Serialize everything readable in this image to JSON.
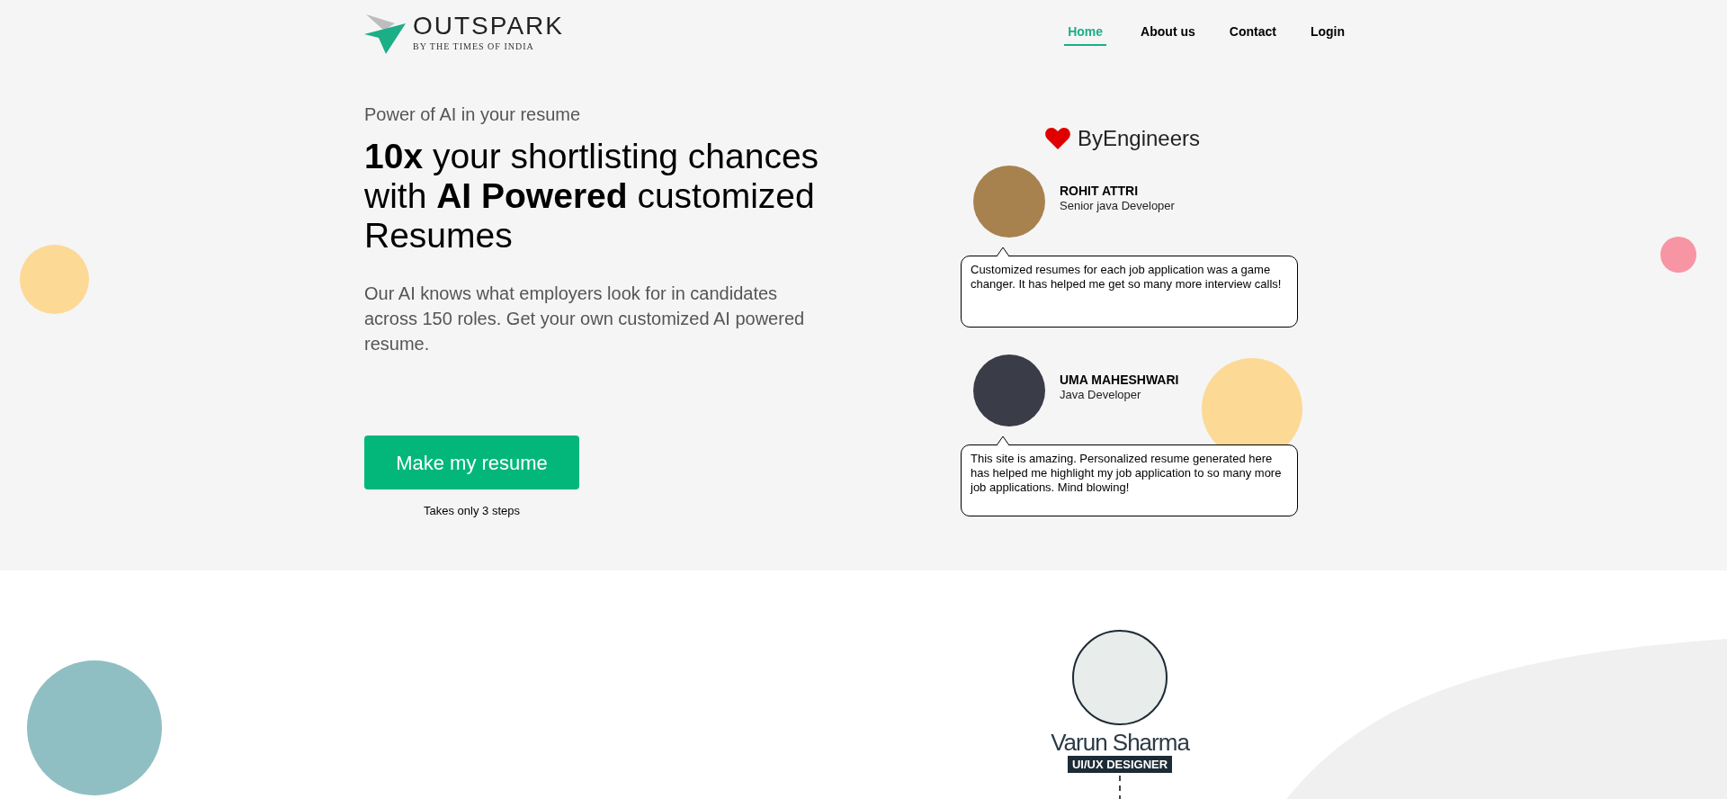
{
  "logo": {
    "name": "OUTSPARK",
    "tagline": "BY THE TIMES OF INDIA"
  },
  "nav": [
    {
      "label": "Home",
      "selected": true
    },
    {
      "label": "About us",
      "selected": false
    },
    {
      "label": "Contact",
      "selected": false
    },
    {
      "label": "Login",
      "selected": false
    }
  ],
  "hero": {
    "eyebrow": "Power of AI in your resume",
    "headline": "**10x** your shortlisting chances with **AI Powered** customized Resumes",
    "description": "Our AI knows what employers look for in candidates across 150 roles. Get your own customized AI powered resume.",
    "button": "Make my resume",
    "button_note": "Takes only 3 steps"
  },
  "testimonials": {
    "title": "ByEngineers",
    "items": [
      {
        "name": "ROHIT ATTRI",
        "role": "Senior java Developer",
        "quote": "Customized resumes for each job application was a game changer. It has helped me get so many more interview calls!"
      },
      {
        "name": "UMA MAHESHWARI",
        "role": "Java Developer",
        "quote": "This site is amazing. Personalized resume generated here has helped me highlight my job application to so many more job applications. Mind blowing!"
      }
    ]
  },
  "team_member": {
    "name": "Varun Sharma",
    "role": "UI/UX DESIGNER"
  }
}
